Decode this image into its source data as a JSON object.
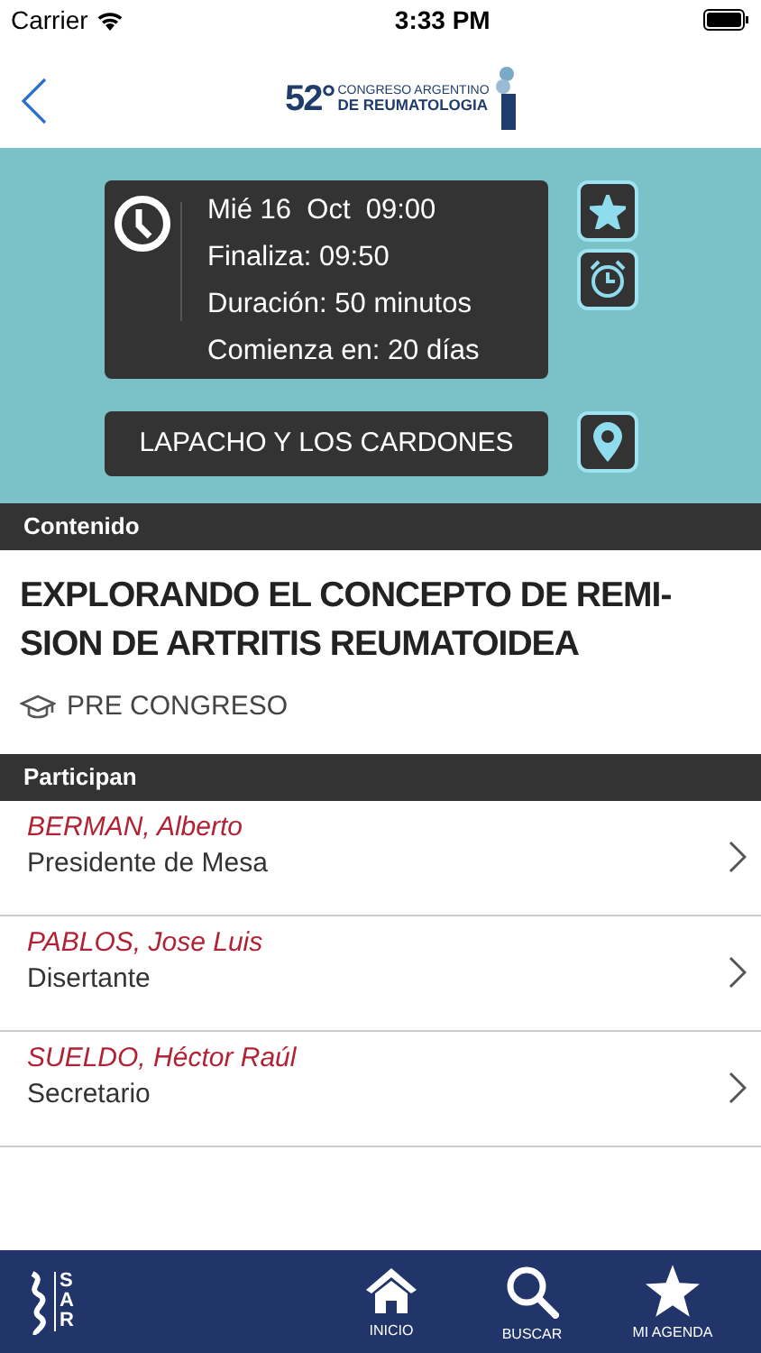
{
  "status_bar": {
    "carrier": "Carrier",
    "time": "3:33 PM"
  },
  "header": {
    "logo": {
      "number": "52°",
      "line_1": "CONGRESO ARGENTINO",
      "line_2": "DE REUMATOLOGIA"
    }
  },
  "schedule": {
    "lines": [
      "Mié 16  Oct  09:00",
      "Finaliza: 09:50",
      "Duración: 50 minutos",
      "Comienza en: 20 días"
    ],
    "favorite": true,
    "location": "LAPACHO Y LOS CARDONES"
  },
  "content": {
    "heading": "Contenido",
    "title": "EXPLORANDO EL CONCEPTO DE REMI-SION DE ARTRITIS REUMATOIDEA",
    "category": "PRE CONGRESO"
  },
  "participants": {
    "heading": "Participan",
    "items": [
      {
        "name": "BERMAN, Alberto",
        "role": "Presidente de Mesa"
      },
      {
        "name": "PABLOS, Jose Luis",
        "role": "Disertante"
      },
      {
        "name": "SUELDO, Héctor Raúl",
        "role": "Secretario"
      }
    ]
  },
  "tab_bar": {
    "logo": [
      "S",
      "A",
      "R"
    ],
    "tabs": [
      {
        "kind": "home",
        "label": "INICIO"
      },
      {
        "kind": "search",
        "label": "BUSCAR"
      },
      {
        "kind": "star",
        "label": "MI AGENDA"
      }
    ]
  }
}
